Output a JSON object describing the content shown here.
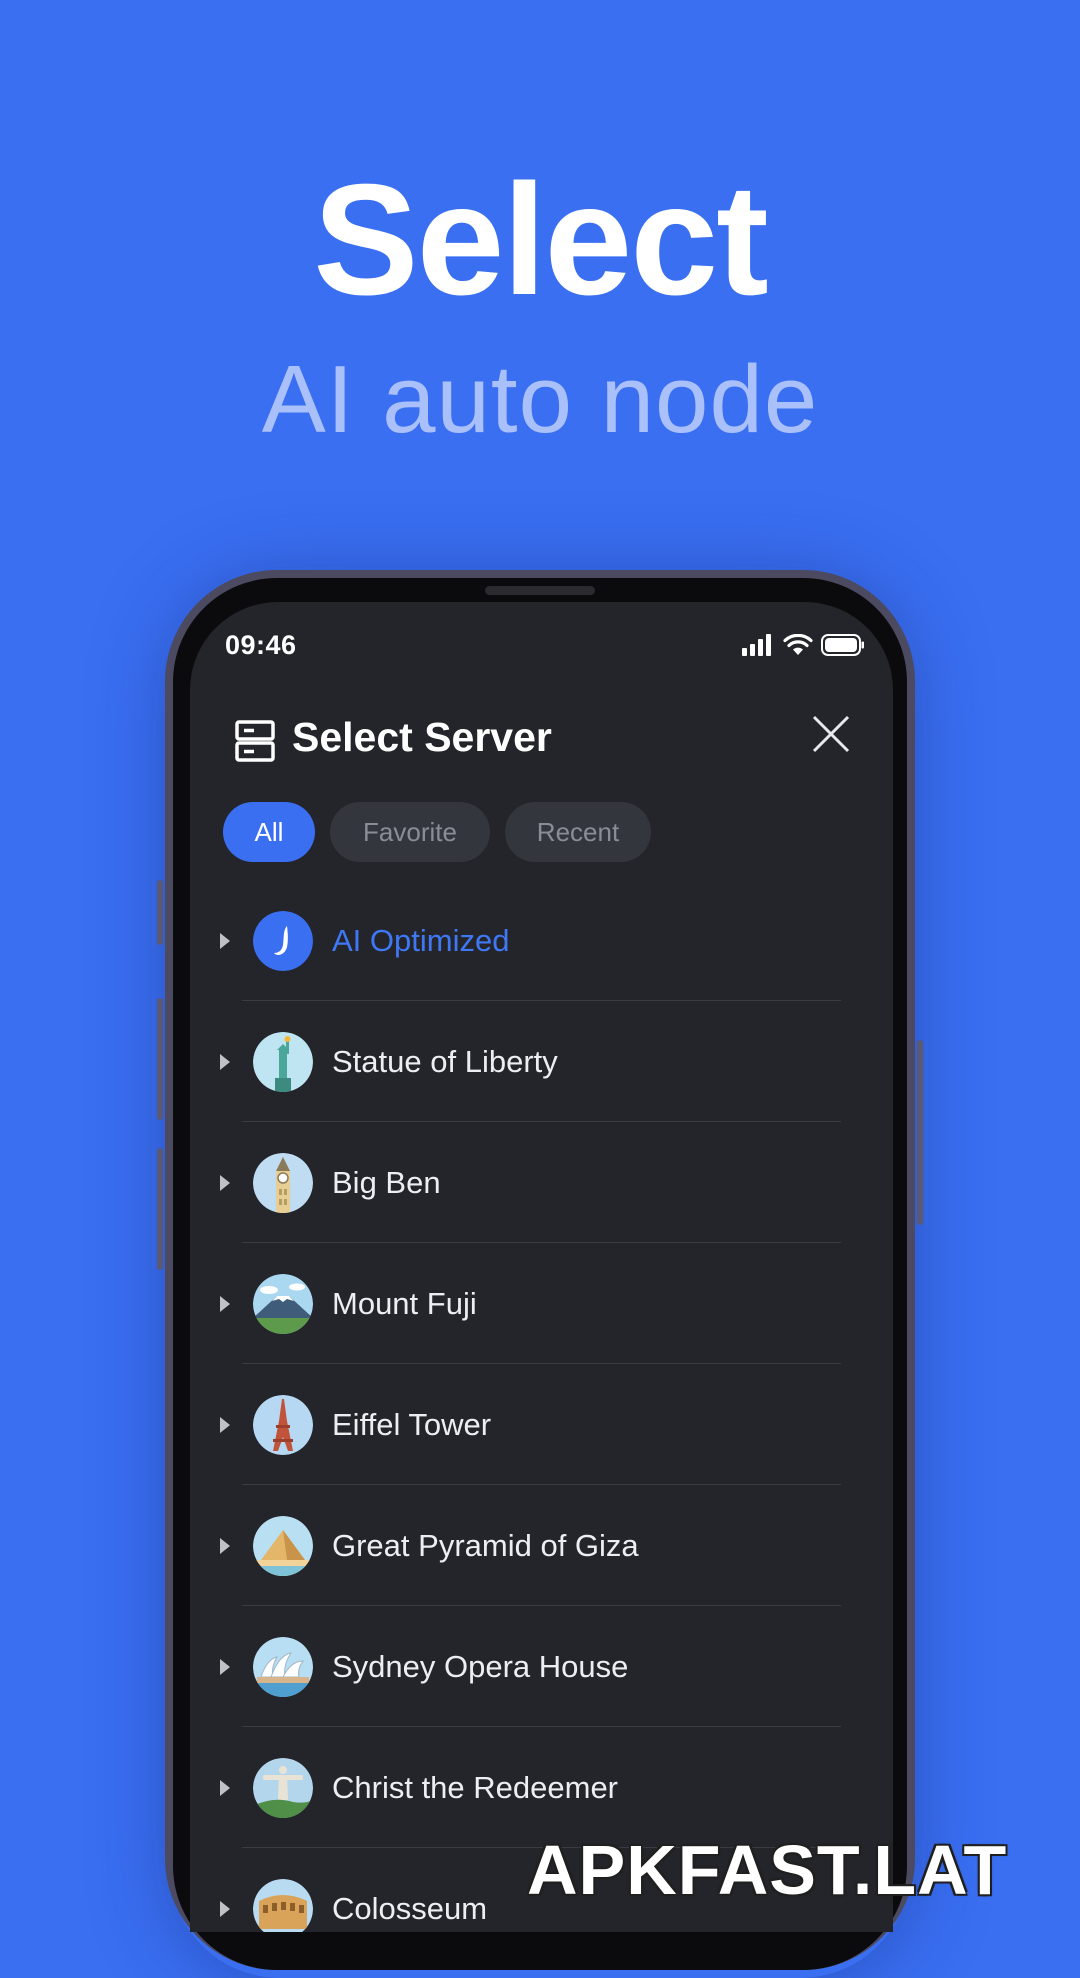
{
  "hero": {
    "title": "Select",
    "subtitle": "AI auto node"
  },
  "status_bar": {
    "time": "09:46",
    "icons": [
      "signal-icon",
      "wifi-icon",
      "battery-icon"
    ]
  },
  "header": {
    "icon": "server-icon",
    "title": "Select Server",
    "close_icon": "close-icon"
  },
  "tabs": [
    {
      "label": "All",
      "active": true
    },
    {
      "label": "Favorite",
      "active": false
    },
    {
      "label": "Recent",
      "active": false
    }
  ],
  "servers": [
    {
      "label": "AI Optimized",
      "icon": "ai-logo-icon",
      "highlight": true
    },
    {
      "label": "Statue of Liberty",
      "icon": "statue-of-liberty-icon"
    },
    {
      "label": "Big Ben",
      "icon": "big-ben-icon"
    },
    {
      "label": "Mount Fuji",
      "icon": "mount-fuji-icon"
    },
    {
      "label": "Eiffel Tower",
      "icon": "eiffel-tower-icon"
    },
    {
      "label": "Great Pyramid of Giza",
      "icon": "pyramid-icon"
    },
    {
      "label": "Sydney Opera House",
      "icon": "opera-house-icon"
    },
    {
      "label": "Christ the Redeemer",
      "icon": "christ-redeemer-icon"
    },
    {
      "label": "Colosseum",
      "icon": "colosseum-icon"
    }
  ],
  "colors": {
    "background": "#3a6ff2",
    "screen": "#24252a",
    "accent": "#3f78f5",
    "subtitle": "#a9c0fb"
  },
  "watermark": "APKFAST.LAT"
}
